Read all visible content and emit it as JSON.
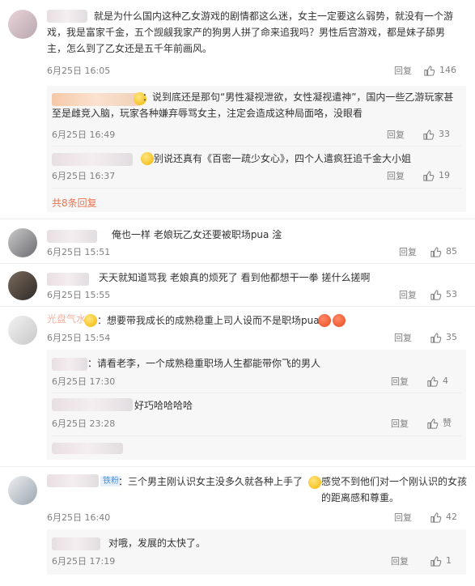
{
  "comments": [
    {
      "text": "就是为什么国内这种乙女游戏的剧情都这么迷，女主一定要这么弱势，就没有一个游戏，我是富家千金，五个觊觎我家产的狗男人拼了命来追我吗？男性后宫游戏，都是妹子舔男主，怎么到了乙女还是五千年前画风。",
      "time": "6月25日 16:05",
      "reply": "回复",
      "likes": "146",
      "replies": [
        {
          "text": "：说到底还是那句“男性凝视泄欲，女性凝视遣神”，国内一些乙游玩家甚至是雌竞入脑，玩家各种嫌弃辱骂女主，注定会造成这种局面咯，没眼看",
          "time": "6月25日 16:49",
          "reply": "回复",
          "likes": "33"
        },
        {
          "text": "别说还真有《百密一疏少女心》，四个人遣疯狂追千金大小姐",
          "time": "6月25日 16:37",
          "reply": "回复",
          "likes": "19"
        }
      ],
      "more": "共8条回复"
    },
    {
      "text": "俺也一样 老娘玩乙女还要被职场pua 淦",
      "time": "6月25日 15:51",
      "reply": "回复",
      "likes": "85"
    },
    {
      "text": "天天就知道骂我 老娘真的烦死了 看到他都想干一拳 搓什么搓啊",
      "time": "6月25日 15:55",
      "reply": "回复",
      "likes": "53"
    },
    {
      "name_hint": "光盘气水",
      "text": "：想要带我成长的成熟稳重上司人设而不是职场pua",
      "time": "6月25日 15:54",
      "reply": "回复",
      "likes": "35",
      "replies": [
        {
          "text": "：请看老李，一个成熟稳重职场人生都能带你飞的男人",
          "time": "6月25日 17:30",
          "reply": "回复",
          "likes": "4"
        },
        {
          "text": "好巧哈哈哈哈",
          "time": "6月25日 23:28",
          "reply": "回复",
          "likes": "赞"
        }
      ]
    },
    {
      "fan_tag": "铁粉",
      "text_a": "：三个男主刚认识女主没多久就各种上手了",
      "text_b": "感觉不到他们对一个刚认识的女孩的距离感和尊重。",
      "time": "6月25日 16:40",
      "reply": "回复",
      "likes": "42",
      "replies": [
        {
          "text": "对哦，发展的太快了。",
          "time": "6月25日 17:19",
          "reply": "回复",
          "likes": "1"
        }
      ]
    }
  ],
  "icons": {
    "like": "thumbs-up-icon",
    "emoji": "emoji-icon"
  },
  "colors": {
    "link": "#eb7350",
    "meta": "#808080",
    "panel": "#f7f7f7"
  }
}
